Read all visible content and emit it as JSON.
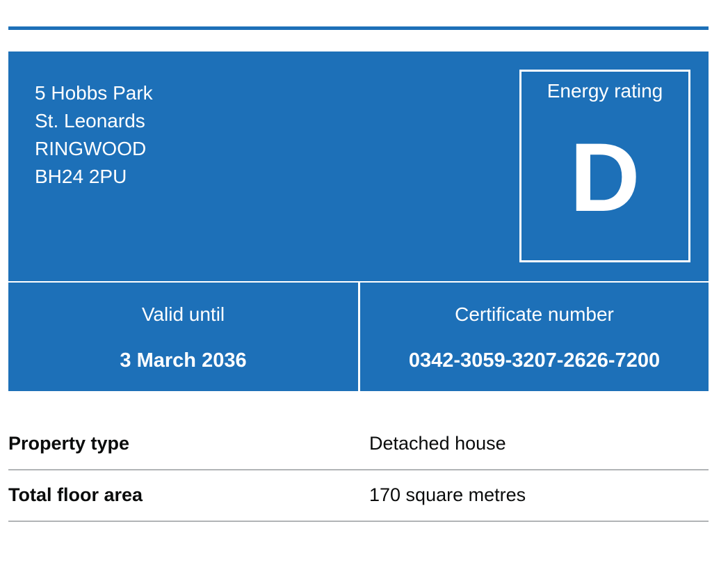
{
  "address": {
    "line1": "5 Hobbs Park",
    "line2": "St. Leonards",
    "line3": "RINGWOOD",
    "postcode": "BH24 2PU"
  },
  "rating": {
    "label": "Energy rating",
    "value": "D"
  },
  "validity": {
    "label": "Valid until",
    "value": "3 March 2036"
  },
  "certificate": {
    "label": "Certificate number",
    "value": "0342-3059-3207-2626-7200"
  },
  "summary": {
    "rows": [
      {
        "key": "Property type",
        "value": "Detached house"
      },
      {
        "key": "Total floor area",
        "value": "170 square metres"
      }
    ]
  },
  "colors": {
    "brand_blue": "#1d70b8",
    "divider_grey": "#b1b4b6"
  }
}
